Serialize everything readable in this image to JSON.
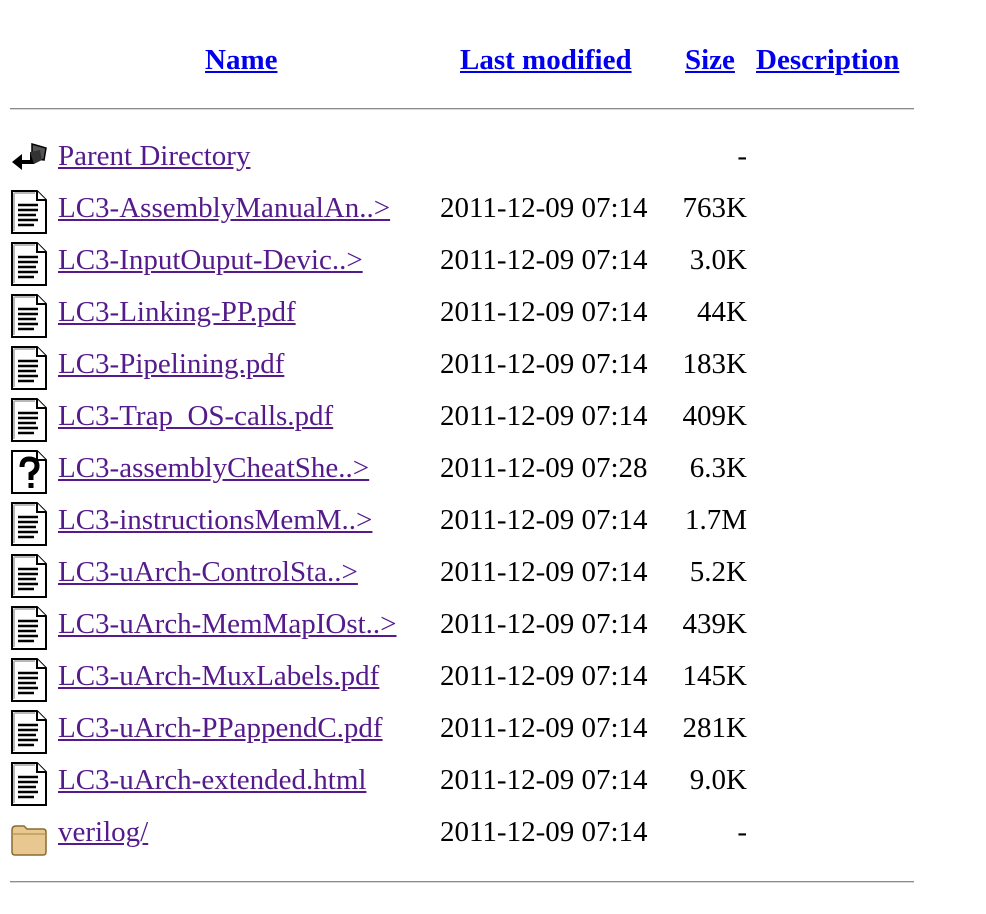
{
  "header": {
    "name": "Name",
    "last_modified": "Last modified",
    "size": "Size",
    "description": "Description"
  },
  "rows": [
    {
      "icon": "back-icon",
      "name": "Parent Directory",
      "date": "",
      "size": "-"
    },
    {
      "icon": "text-icon",
      "name": "LC3-AssemblyManualAn..>",
      "date": "2011-12-09 07:14",
      "size": "763K"
    },
    {
      "icon": "text-icon",
      "name": "LC3-InputOuput-Devic..>",
      "date": "2011-12-09 07:14",
      "size": "3.0K"
    },
    {
      "icon": "text-icon",
      "name": "LC3-Linking-PP.pdf",
      "date": "2011-12-09 07:14",
      "size": "44K"
    },
    {
      "icon": "text-icon",
      "name": "LC3-Pipelining.pdf",
      "date": "2011-12-09 07:14",
      "size": "183K"
    },
    {
      "icon": "text-icon",
      "name": "LC3-Trap_OS-calls.pdf",
      "date": "2011-12-09 07:14",
      "size": "409K"
    },
    {
      "icon": "unknown-icon",
      "name": "LC3-assemblyCheatShe..>",
      "date": "2011-12-09 07:28",
      "size": "6.3K"
    },
    {
      "icon": "text-icon",
      "name": "LC3-instructionsMemM..>",
      "date": "2011-12-09 07:14",
      "size": "1.7M"
    },
    {
      "icon": "text-icon",
      "name": "LC3-uArch-ControlSta..>",
      "date": "2011-12-09 07:14",
      "size": "5.2K"
    },
    {
      "icon": "text-icon",
      "name": "LC3-uArch-MemMapIOst..>",
      "date": "2011-12-09 07:14",
      "size": "439K"
    },
    {
      "icon": "text-icon",
      "name": "LC3-uArch-MuxLabels.pdf",
      "date": "2011-12-09 07:14",
      "size": "145K"
    },
    {
      "icon": "text-icon",
      "name": "LC3-uArch-PPappendC.pdf",
      "date": "2011-12-09 07:14",
      "size": "281K"
    },
    {
      "icon": "text-icon",
      "name": "LC3-uArch-extended.html",
      "date": "2011-12-09 07:14",
      "size": "9.0K"
    },
    {
      "icon": "folder-icon",
      "name": "verilog/",
      "date": "2011-12-09 07:14",
      "size": "-"
    }
  ],
  "colors": {
    "header_link": "#0000ee",
    "visited_link": "#551a8b",
    "folder": "#e8c890"
  }
}
